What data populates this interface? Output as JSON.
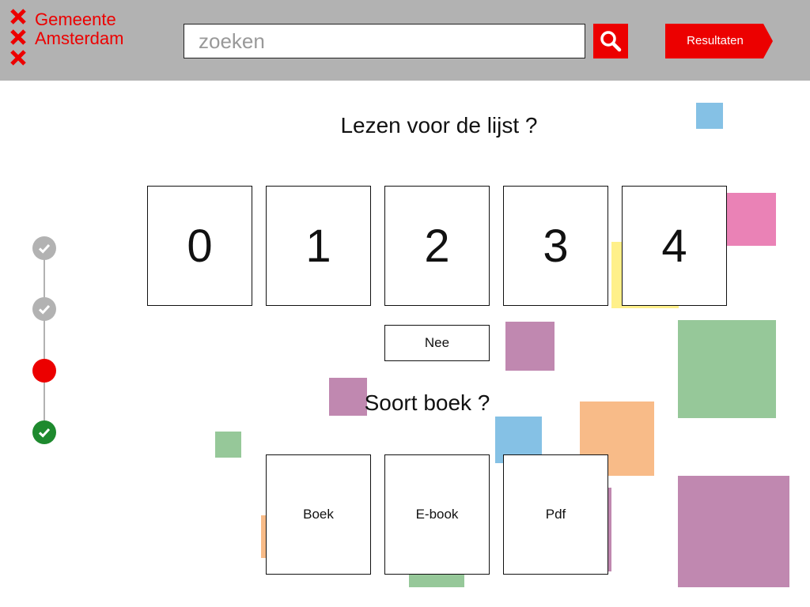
{
  "brand": {
    "line1": "Gemeente",
    "line2": "Amsterdam",
    "color": "#ec0000",
    "icon": "andreas-cross-icon"
  },
  "search": {
    "placeholder": "zoeken",
    "value": "",
    "button_icon": "search-icon"
  },
  "results_button": {
    "label": "Resultaten"
  },
  "stepper": {
    "steps": [
      {
        "state": "done",
        "color": "#b2b2b2",
        "icon": "check-icon"
      },
      {
        "state": "done",
        "color": "#b2b2b2",
        "icon": "check-icon"
      },
      {
        "state": "current",
        "color": "#ec0000",
        "icon": ""
      },
      {
        "state": "done-final",
        "color": "#1e8a2e",
        "icon": "check-icon"
      }
    ]
  },
  "question1": {
    "title": "Lezen voor de lijst ?",
    "options": [
      "0",
      "1",
      "2",
      "3",
      "4"
    ],
    "no_option": "Nee"
  },
  "question2": {
    "title": "Soort boek ?",
    "options": [
      "Boek",
      "E-book",
      "Pdf"
    ]
  },
  "colors": {
    "header_bg": "#b2b2b2",
    "accent": "#ec0000",
    "deco_blue": "#85c1e5",
    "deco_pink": "#ea82b6",
    "deco_yellow": "#fff08a",
    "deco_purple": "#c088b0",
    "deco_green": "#96c899",
    "deco_orange": "#f8bb88"
  }
}
